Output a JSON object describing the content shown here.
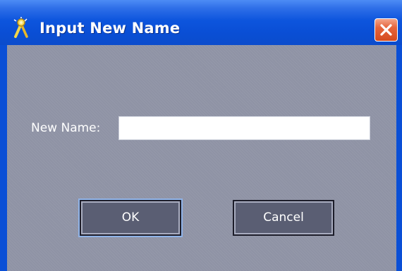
{
  "window": {
    "title": "Input New Name",
    "title_icon": "key-wizard-icon",
    "close_icon": "close-icon"
  },
  "form": {
    "label": "New Name:",
    "value": "",
    "placeholder": ""
  },
  "buttons": {
    "ok_label": "OK",
    "cancel_label": "Cancel"
  },
  "colors": {
    "titlebar": "#0a4fd6",
    "client_background": "#8f93a5",
    "button_face": "#5a5e73",
    "close_button": "#d44b1e"
  }
}
